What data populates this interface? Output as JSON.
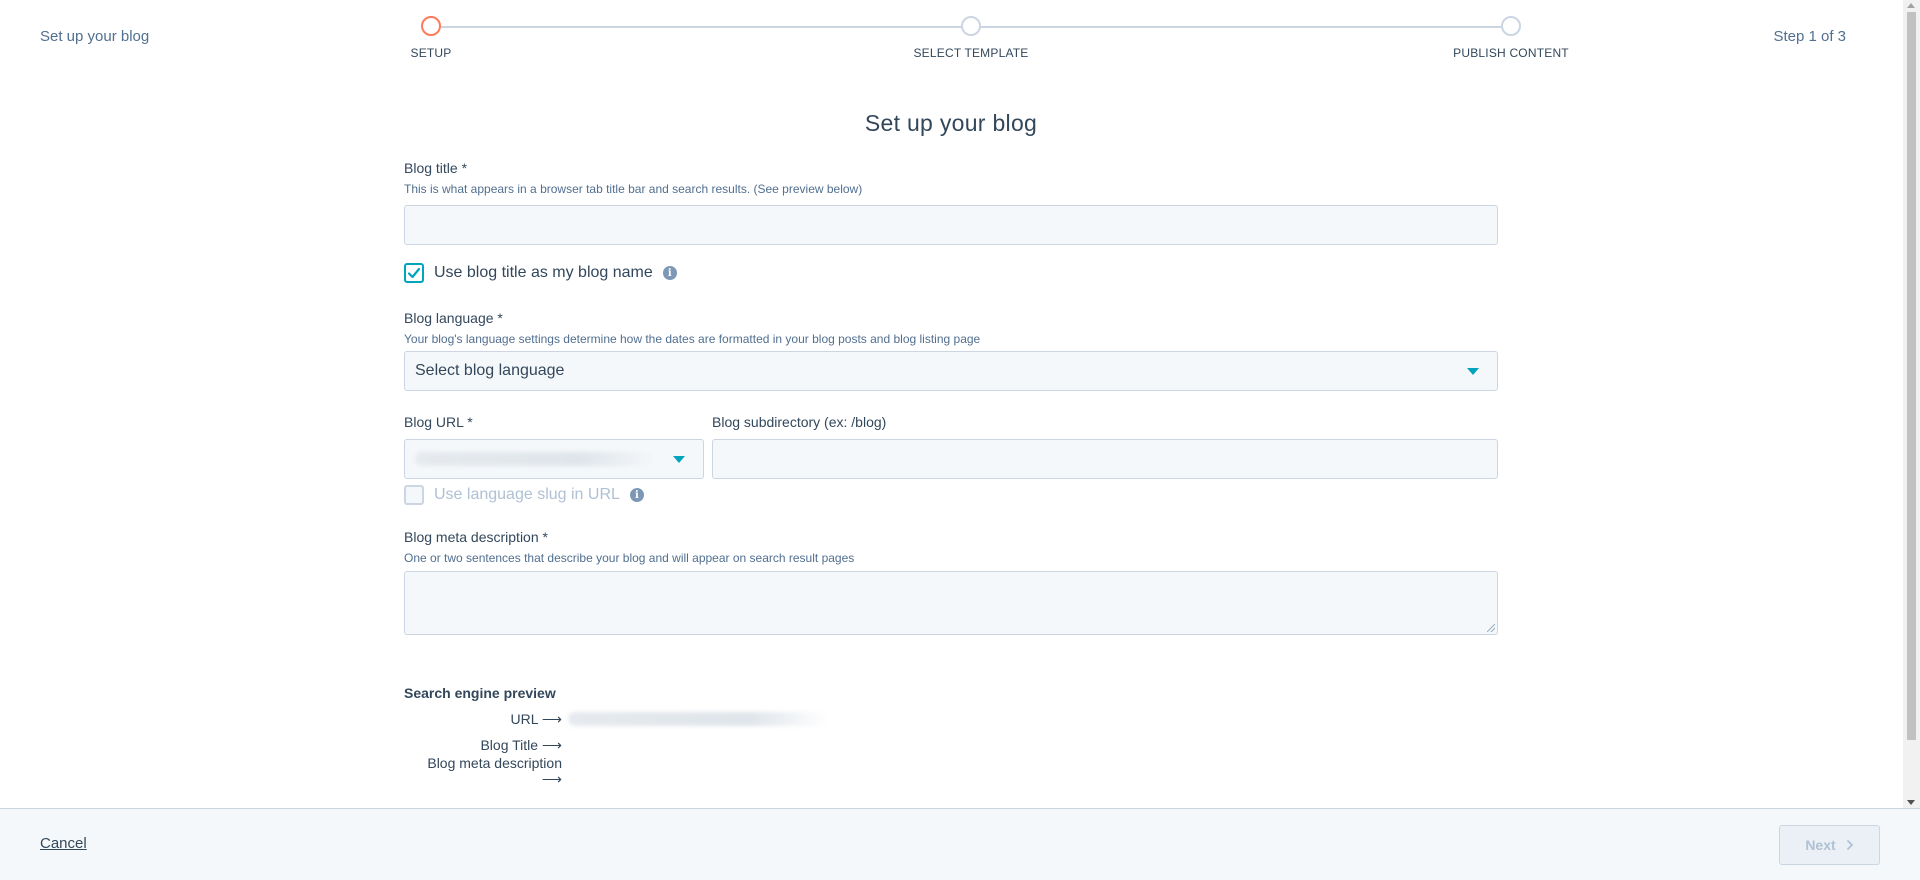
{
  "header": {
    "title": "Set up your blog",
    "step_indicator": "Step 1 of 3",
    "steps": [
      {
        "label": "SETUP",
        "active": true
      },
      {
        "label": "SELECT TEMPLATE",
        "active": false
      },
      {
        "label": "PUBLISH CONTENT",
        "active": false
      }
    ]
  },
  "form": {
    "title": "Set up your blog",
    "blog_title": {
      "label": "Blog title *",
      "help": "This is what appears in a browser tab title bar and search results. (See preview below)",
      "value": ""
    },
    "use_title_as_name": {
      "label": "Use blog title as my blog name",
      "checked": true,
      "info_icon": "info-icon"
    },
    "blog_language": {
      "label": "Blog language *",
      "help": "Your blog's language settings determine how the dates are formatted in your blog posts and blog listing page",
      "placeholder": "Select blog language"
    },
    "blog_url": {
      "label": "Blog URL *",
      "value": ""
    },
    "blog_subdirectory": {
      "label": "Blog subdirectory (ex: /blog)",
      "value": ""
    },
    "language_slug": {
      "label": "Use language slug in URL",
      "checked": false,
      "disabled": true,
      "info_icon": "info-icon"
    },
    "meta_description": {
      "label": "Blog meta description *",
      "help": "One or two sentences that describe your blog and will appear on search result pages",
      "value": ""
    },
    "preview": {
      "title": "Search engine preview",
      "rows": [
        {
          "key": "URL ⟶",
          "value": ""
        },
        {
          "key": "Blog Title ⟶",
          "value": ""
        },
        {
          "key": "Blog meta description ⟶",
          "value": ""
        }
      ]
    }
  },
  "footer": {
    "cancel_label": "Cancel",
    "next_label": "Next",
    "next_disabled": true
  },
  "colors": {
    "accent": "#00a4bd",
    "active_step": "#ff7a59",
    "text": "#33475b",
    "muted": "#516f90"
  }
}
